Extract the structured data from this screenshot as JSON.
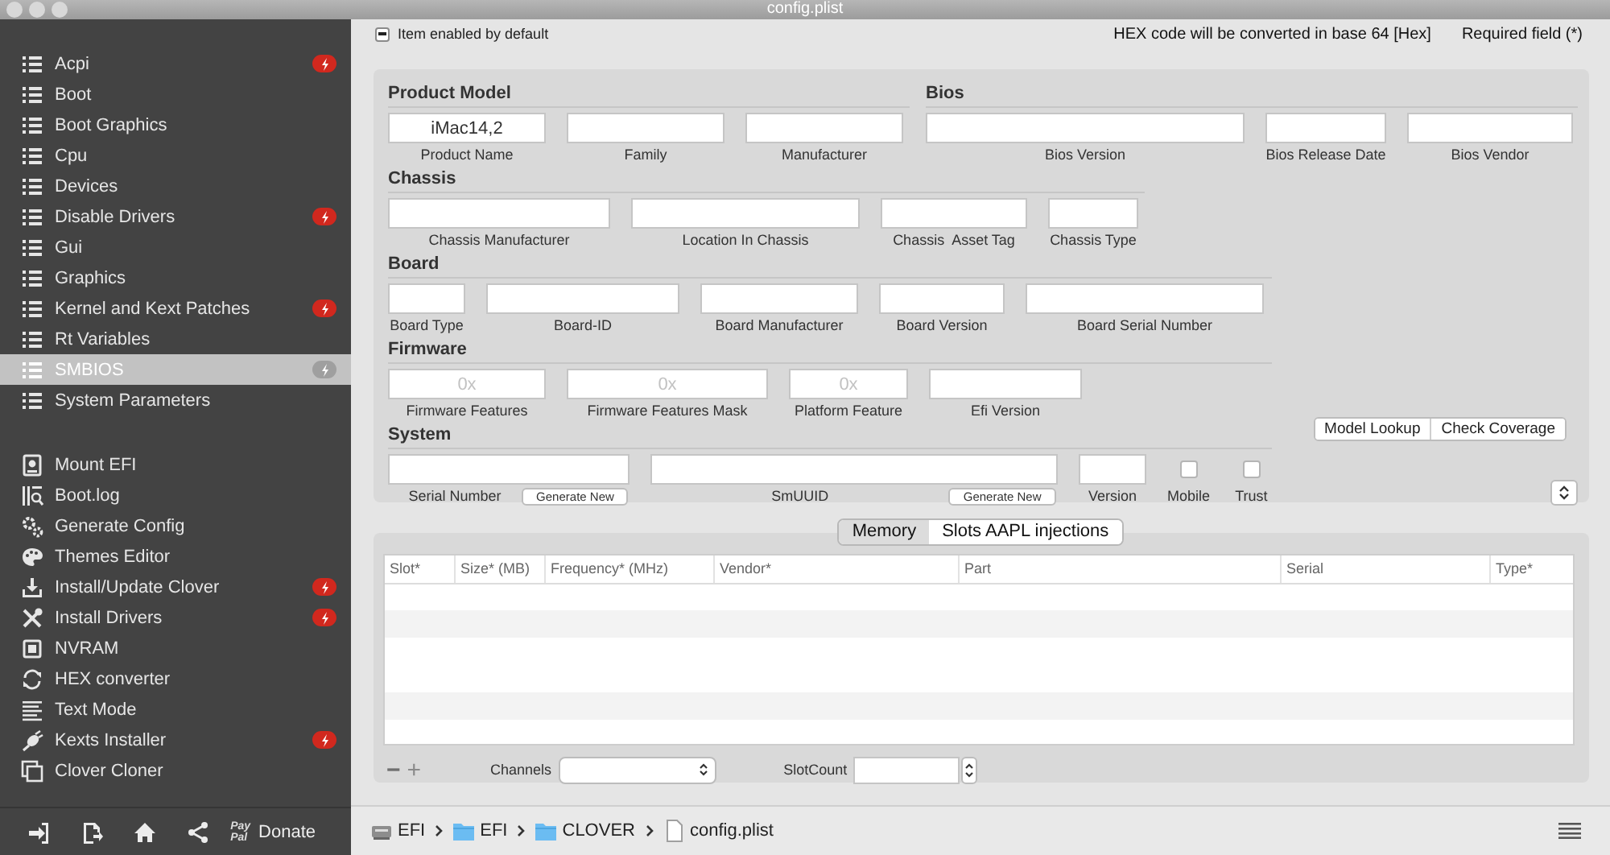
{
  "window": {
    "title": "config.plist"
  },
  "sidebar": {
    "items": [
      {
        "label": "Acpi",
        "kind": "list",
        "badge": true,
        "selected": false
      },
      {
        "label": "Boot",
        "kind": "list",
        "badge": false,
        "selected": false
      },
      {
        "label": "Boot Graphics",
        "kind": "list",
        "badge": false,
        "selected": false
      },
      {
        "label": "Cpu",
        "kind": "list",
        "badge": false,
        "selected": false
      },
      {
        "label": "Devices",
        "kind": "list",
        "badge": false,
        "selected": false
      },
      {
        "label": "Disable Drivers",
        "kind": "list",
        "badge": true,
        "selected": false
      },
      {
        "label": "Gui",
        "kind": "list",
        "badge": false,
        "selected": false
      },
      {
        "label": "Graphics",
        "kind": "list",
        "badge": false,
        "selected": false
      },
      {
        "label": "Kernel and Kext Patches",
        "kind": "list",
        "badge": true,
        "selected": false
      },
      {
        "label": "Rt Variables",
        "kind": "list",
        "badge": false,
        "selected": false
      },
      {
        "label": "SMBIOS",
        "kind": "list",
        "badge": true,
        "selected": true
      },
      {
        "label": "System Parameters",
        "kind": "list",
        "badge": false,
        "selected": false
      }
    ],
    "tools": [
      {
        "label": "Mount EFI",
        "kind": "disk",
        "badge": false
      },
      {
        "label": "Boot.log",
        "kind": "log",
        "badge": false
      },
      {
        "label": "Generate Config",
        "kind": "gears",
        "badge": false
      },
      {
        "label": "Themes Editor",
        "kind": "palette",
        "badge": false
      },
      {
        "label": "Install/Update Clover",
        "kind": "download",
        "badge": true
      },
      {
        "label": "Install Drivers",
        "kind": "tools",
        "badge": true
      },
      {
        "label": "NVRAM",
        "kind": "chip",
        "badge": false
      },
      {
        "label": "HEX converter",
        "kind": "refresh",
        "badge": false
      },
      {
        "label": "Text Mode",
        "kind": "lines",
        "badge": false
      },
      {
        "label": "Kexts Installer",
        "kind": "plug",
        "badge": true
      },
      {
        "label": "Clover Cloner",
        "kind": "copy",
        "badge": false
      }
    ],
    "donate": {
      "label": "Donate",
      "logo_lines": [
        "Pay",
        "Pal"
      ]
    }
  },
  "options": {
    "enabled_default": {
      "label": "Item enabled by default",
      "checked": true
    },
    "hex_note": "HEX code will be converted in base 64 [Hex]",
    "required_note": "Required field (*)"
  },
  "smbios": {
    "sections": [
      {
        "title": "Product Model",
        "fields": [
          {
            "label": "Product Name",
            "value": "iMac14,2"
          },
          {
            "label": "Family"
          },
          {
            "label": "Manufacturer"
          }
        ]
      },
      {
        "title": "Bios",
        "fields": [
          {
            "label": "Bios Version"
          },
          {
            "label": "Bios Release Date"
          },
          {
            "label": "Bios Vendor"
          }
        ]
      },
      {
        "title": "Chassis",
        "fields": [
          {
            "label": "Chassis Manufacturer"
          },
          {
            "label": "Location In Chassis"
          },
          {
            "label": "Chassis  Asset Tag"
          },
          {
            "label": "Chassis Type"
          }
        ]
      },
      {
        "title": "Board",
        "fields": [
          {
            "label": "Board Type"
          },
          {
            "label": "Board-ID"
          },
          {
            "label": "Board Manufacturer"
          },
          {
            "label": "Board Version"
          },
          {
            "label": "Board Serial Number"
          }
        ]
      },
      {
        "title": "Firmware",
        "fields": [
          {
            "label": "Firmware Features",
            "placeholder": "0x"
          },
          {
            "label": "Firmware Features Mask",
            "placeholder": "0x"
          },
          {
            "label": "Platform Feature",
            "placeholder": "0x"
          },
          {
            "label": "Efi Version"
          }
        ]
      },
      {
        "title": "System",
        "fields": [
          {
            "kind": "text",
            "label": "Serial Number",
            "button": "Generate New"
          },
          {
            "kind": "text",
            "label": "SmUUID",
            "button": "Generate New"
          },
          {
            "kind": "text",
            "label": "Version"
          },
          {
            "kind": "check",
            "label": "Mobile",
            "checked": false
          },
          {
            "kind": "check",
            "label": "Trust",
            "checked": false
          }
        ]
      }
    ],
    "lookup_buttons": [
      "Model Lookup",
      "Check Coverage"
    ]
  },
  "memory": {
    "tabs": [
      {
        "label": "Memory",
        "selected": true
      },
      {
        "label": "Slots AAPL injections",
        "selected": false
      }
    ],
    "table": {
      "columns": [
        "Slot*",
        "Size* (MB)",
        "Frequency* (MHz)",
        "Vendor*",
        "Part",
        "Serial",
        "Type*"
      ]
    },
    "row_buttons": [
      {
        "label": "−",
        "disabled": true
      },
      {
        "label": "+",
        "disabled": false
      }
    ],
    "channels_label": "Channels",
    "slot_count_label": "SlotCount"
  },
  "path_bar": {
    "items": [
      {
        "label": "EFI",
        "kind": "disk"
      },
      {
        "label": "EFI",
        "kind": "folder"
      },
      {
        "label": "CLOVER",
        "kind": "folder"
      },
      {
        "label": "config.plist",
        "kind": "file"
      }
    ]
  }
}
